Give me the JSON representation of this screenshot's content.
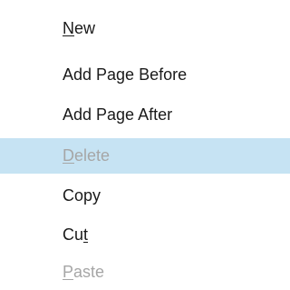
{
  "menu": {
    "items": [
      {
        "before": "",
        "mnemonic": "N",
        "after": "ew",
        "state": "enabled"
      },
      {
        "before": "Add Page Before",
        "mnemonic": "",
        "after": "",
        "state": "enabled"
      },
      {
        "before": "Add Page After",
        "mnemonic": "",
        "after": "",
        "state": "enabled"
      },
      {
        "before": "",
        "mnemonic": "D",
        "after": "elete",
        "state": "disabled-highlighted"
      },
      {
        "before": "Copy",
        "mnemonic": "",
        "after": "",
        "state": "enabled"
      },
      {
        "before": "Cu",
        "mnemonic": "t",
        "after": "",
        "state": "enabled"
      },
      {
        "before": "",
        "mnemonic": "P",
        "after": "aste",
        "state": "disabled"
      }
    ]
  },
  "colors": {
    "text": "#1a1a1a",
    "disabled_text": "#a6a6a6",
    "highlight": "#c6e3f3",
    "background": "#ffffff"
  }
}
